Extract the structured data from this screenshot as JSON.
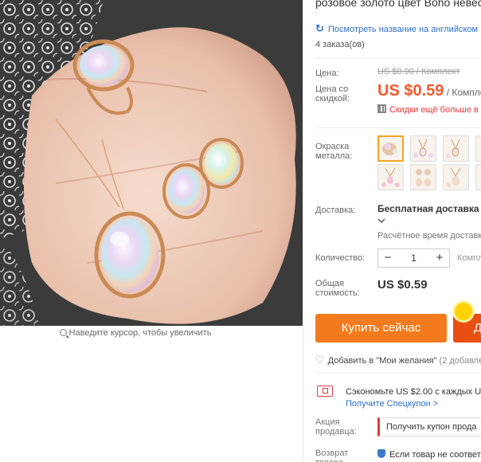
{
  "title": "розовое золото цвет Boho невес",
  "translate_link": "Посмотреть название на английском",
  "orders": "4 заказа(ов)",
  "zoom_hint": "Наведите курсор, чтобы увеличить",
  "price": {
    "label": "Цена:",
    "old": "US $0.90 / Комплект",
    "discount_label": "Цена со скидкой:",
    "new": "US $0.59",
    "unit": " / Комплект",
    "more_discounts": "Скидки ещё больше в"
  },
  "color": {
    "label": "Окраска металла:",
    "swatch_count": 8,
    "selected_index": 0
  },
  "shipping": {
    "label": "Доставка:",
    "text": "Бесплатная доставка в",
    "estimate": "Расчётное время доставки"
  },
  "quantity": {
    "label": "Количество:",
    "value": "1",
    "minus": "−",
    "plus": "+",
    "unit_note": "Компл"
  },
  "total": {
    "label": "Общая стоимость:",
    "value": "US $0.59"
  },
  "buttons": {
    "buy_now": "Купить сейчас",
    "add_to_cart": "До"
  },
  "wishlist": {
    "label": "Добавить в \"Мои желания\"",
    "count": "(2 добавле"
  },
  "coupon": {
    "save": "Сэкономьте US $2.00 с каждых US",
    "link": "Получите Спецкупон >"
  },
  "seller_promo": {
    "label": "Акция продавца:",
    "button": "Получить купон прода"
  },
  "returns": {
    "label": "Возврат товара",
    "text": "Если товар не соответ"
  },
  "colors": {
    "accent_orange": "#f37b1d",
    "cart_red": "#e94e12",
    "price_red": "#f5582c",
    "link_blue": "#2d6ec8"
  }
}
